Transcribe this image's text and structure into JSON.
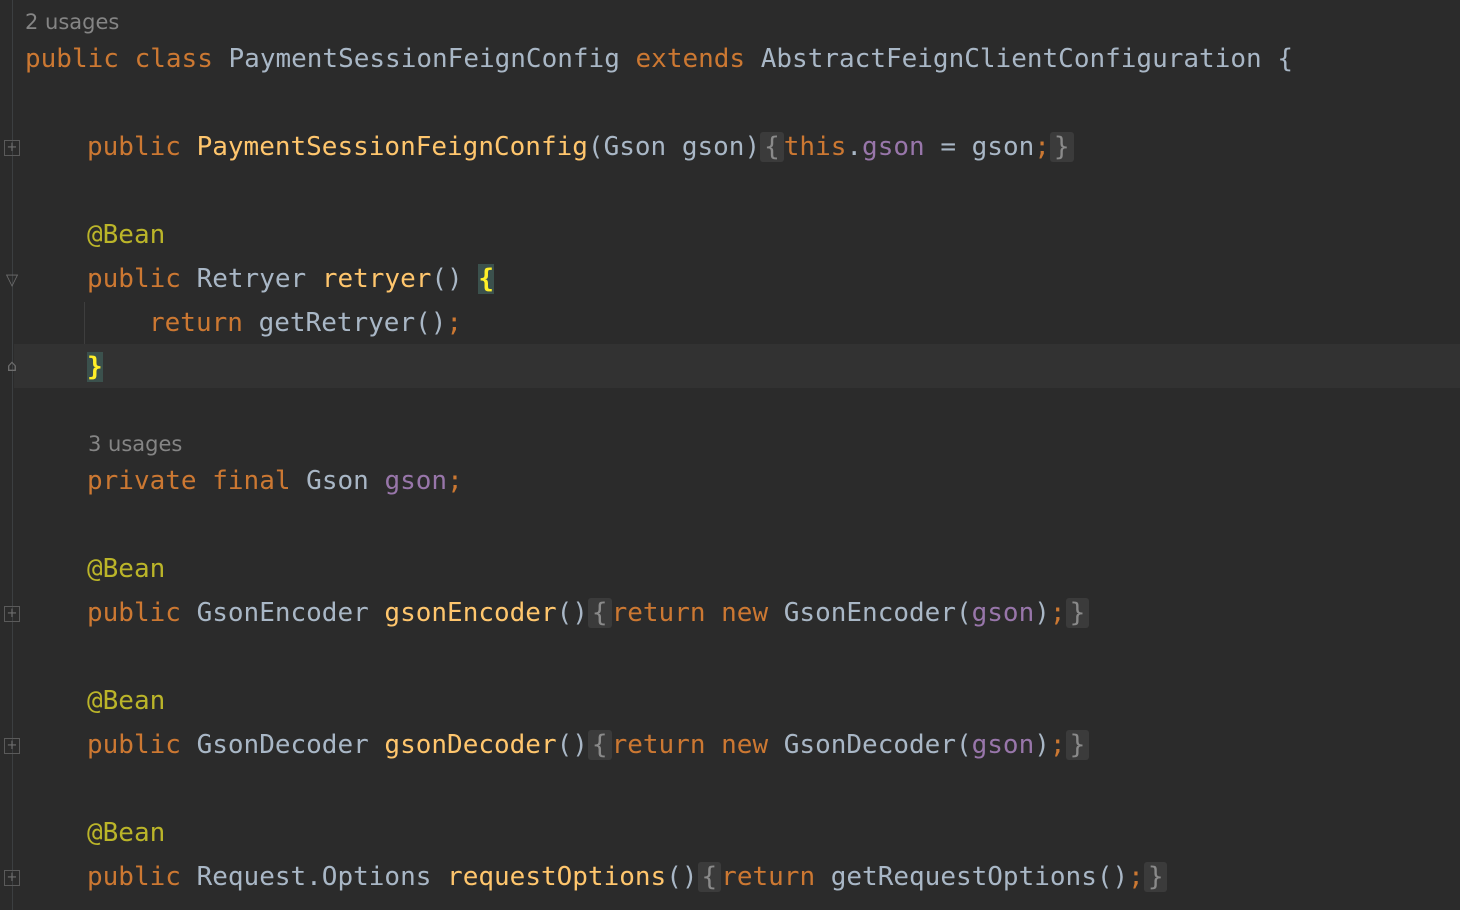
{
  "hints": {
    "class_usages": "2 usages",
    "field_usages": "3 usages"
  },
  "code": {
    "class_decl": {
      "kw_public": "public",
      "kw_class": "class",
      "name": "PaymentSessionFeignConfig",
      "kw_extends": "extends",
      "parent": "AbstractFeignClientConfiguration",
      "brace": "{"
    },
    "ctor": {
      "kw_public": "public",
      "name": "PaymentSessionFeignConfig",
      "params": "(Gson gson)",
      "open": "{",
      "this_kw": "this",
      "dot": ".",
      "field": "gson",
      "assign": " = gson",
      "semi": ";",
      "close": "}"
    },
    "retryer": {
      "annotation": "@Bean",
      "kw_public": "public",
      "type": "Retryer",
      "name": "retryer",
      "parens": "()",
      "open": "{",
      "kw_return": "return",
      "body": "getRetryer()",
      "semi": ";",
      "close": "}"
    },
    "field_decl": {
      "kw_private": "private",
      "kw_final": "final",
      "type": "Gson",
      "name": "gson",
      "semi": ";"
    },
    "encoder": {
      "annotation": "@Bean",
      "kw_public": "public",
      "type": "GsonEncoder",
      "name": "gsonEncoder",
      "parens": "()",
      "open": "{",
      "kw_return": "return",
      "kw_new": "new",
      "ctor_call": "GsonEncoder(",
      "arg": "gson",
      "end": ")",
      "semi": ";",
      "close": "}"
    },
    "decoder": {
      "annotation": "@Bean",
      "kw_public": "public",
      "type": "GsonDecoder",
      "name": "gsonDecoder",
      "parens": "()",
      "open": "{",
      "kw_return": "return",
      "kw_new": "new",
      "ctor_call": "GsonDecoder(",
      "arg": "gson",
      "end": ")",
      "semi": ";",
      "close": "}"
    },
    "options": {
      "annotation": "@Bean",
      "kw_public": "public",
      "type": "Request.Options",
      "name": "requestOptions",
      "parens": "()",
      "open": "{",
      "kw_return": "return",
      "body": "getRequestOptions()",
      "semi": ";",
      "close": "}"
    }
  },
  "icons": {
    "fold_expand": "fold-expand-icon",
    "fold_collapse": "fold-collapse-icon"
  },
  "colors": {
    "background": "#2b2b2b",
    "keyword": "#cc7832",
    "method": "#ffc66d",
    "annotation": "#bbb529",
    "field": "#9876aa",
    "text": "#a9b7c6",
    "brace_match": "#ffef28"
  }
}
